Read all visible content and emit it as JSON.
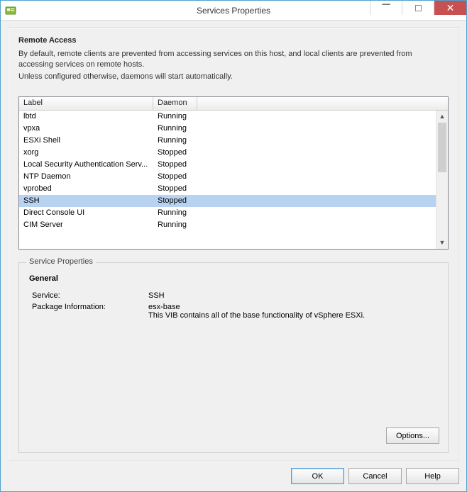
{
  "window": {
    "title": "Services Properties"
  },
  "section": {
    "title": "Remote Access",
    "desc1": "By default, remote clients are prevented from accessing services on this host, and local clients are prevented from accessing services on remote hosts.",
    "desc2": "Unless configured otherwise, daemons will start automatically."
  },
  "list": {
    "headers": {
      "label": "Label",
      "daemon": "Daemon"
    },
    "rows": [
      {
        "label": "lbtd",
        "daemon": "Running",
        "selected": false
      },
      {
        "label": "vpxa",
        "daemon": "Running",
        "selected": false
      },
      {
        "label": "ESXi Shell",
        "daemon": "Running",
        "selected": false
      },
      {
        "label": "xorg",
        "daemon": "Stopped",
        "selected": false
      },
      {
        "label": "Local Security Authentication Serv...",
        "daemon": "Stopped",
        "selected": false
      },
      {
        "label": "NTP Daemon",
        "daemon": "Stopped",
        "selected": false
      },
      {
        "label": "vprobed",
        "daemon": "Stopped",
        "selected": false
      },
      {
        "label": "SSH",
        "daemon": "Stopped",
        "selected": true
      },
      {
        "label": "Direct Console UI",
        "daemon": "Running",
        "selected": false
      },
      {
        "label": "CIM Server",
        "daemon": "Running",
        "selected": false
      }
    ]
  },
  "props": {
    "legend": "Service Properties",
    "general_title": "General",
    "service_label": "Service:",
    "service_value": "SSH",
    "pkg_label": "Package Information:",
    "pkg_value_name": "esx-base",
    "pkg_value_desc": "This VIB contains all of the base functionality of vSphere ESXi."
  },
  "buttons": {
    "options": "Options...",
    "ok": "OK",
    "cancel": "Cancel",
    "help": "Help"
  }
}
